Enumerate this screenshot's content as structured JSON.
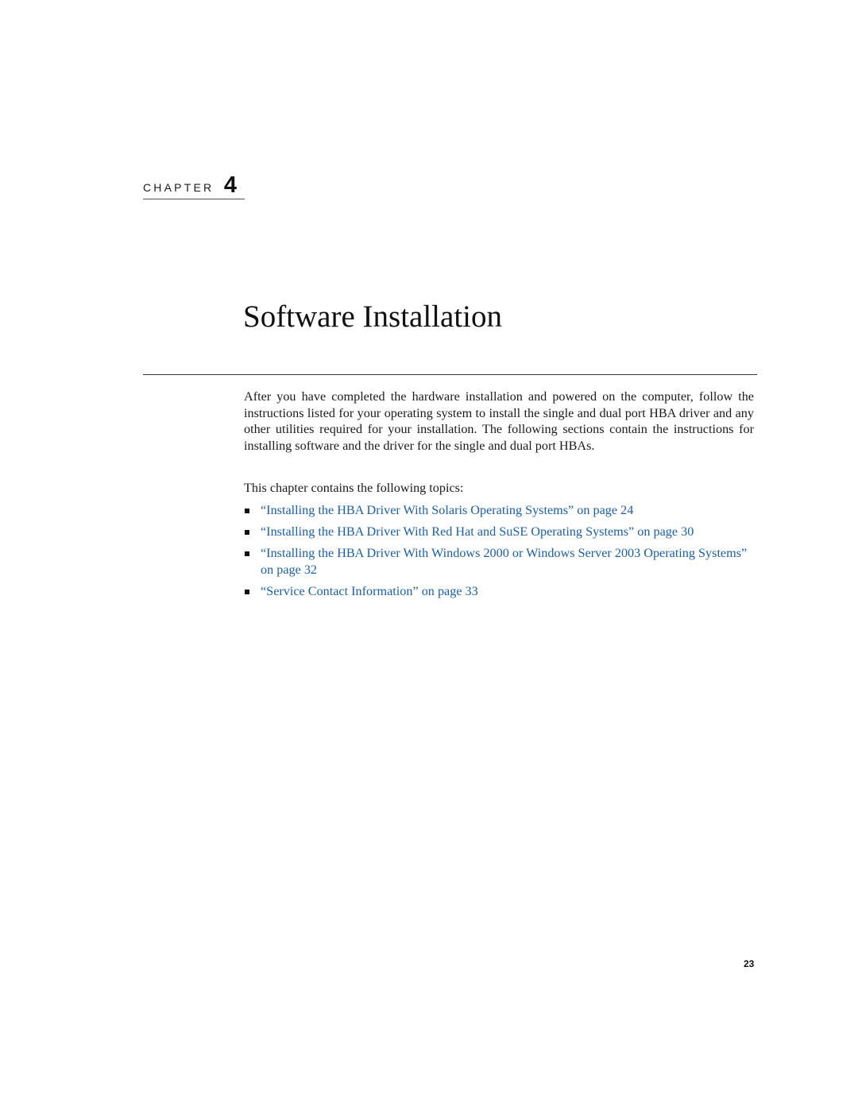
{
  "chapter": {
    "label": "CHAPTER",
    "number": "4"
  },
  "title": "Software Installation",
  "intro": "After you have completed the hardware installation and powered on the computer, follow the instructions listed for your operating system to install the single and dual port HBA driver and any other utilities required for your installation. The following sections contain the instructions for installing software and the driver for the single and dual port HBAs.",
  "topics_lead": "This chapter contains the following topics:",
  "topics": [
    {
      "text": "“Installing the HBA Driver With Solaris Operating Systems” on page 24"
    },
    {
      "text": "“Installing the HBA Driver With Red Hat and SuSE Operating Systems” on page 30"
    },
    {
      "text": "“Installing the HBA Driver With Windows 2000 or Windows Server 2003 Operating Systems” on page 32"
    },
    {
      "text": "“Service Contact Information” on page 33"
    }
  ],
  "page_number": "23",
  "colors": {
    "link": "#1a5fa8",
    "text": "#1a1a1a"
  }
}
